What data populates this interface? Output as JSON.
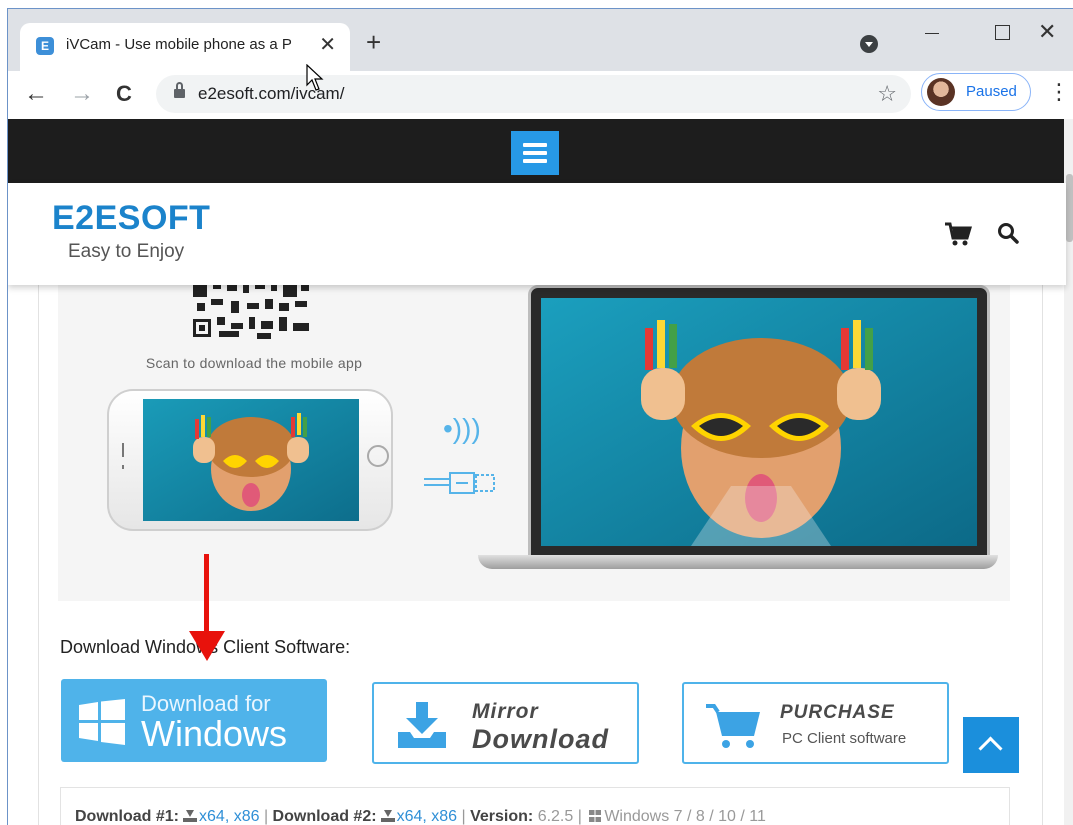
{
  "browser": {
    "tab_title": "iVCam - Use mobile phone as a P",
    "tab_favicon_letter": "E",
    "tab_close_glyph": "✕",
    "new_tab_glyph": "+",
    "url": "e2esoft.com/ivcam/",
    "profile_status": "Paused",
    "back_glyph": "←",
    "forward_glyph": "→",
    "reload_glyph": "C",
    "star_glyph": "☆",
    "menu_glyph": "⋮",
    "close_window_glyph": "✕"
  },
  "site": {
    "logo": "E2ESOFT",
    "tagline": "Easy to Enjoy",
    "accent_color": "#2799e6"
  },
  "hero": {
    "scan_text": "Scan to download the mobile app",
    "wireless_glyph": "•)))"
  },
  "download": {
    "heading": "Download Windows Client Software:",
    "windows_button": {
      "line1": "Download for",
      "line2": "Windows"
    },
    "mirror_button": {
      "line1": "Mirror",
      "line2": "Download"
    },
    "purchase_button": {
      "line1": "PURCHASE",
      "line2": "PC Client software"
    }
  },
  "info": {
    "label1": "Download #1:",
    "link1a": "x64",
    "link1b": "x86",
    "label2": "Download #2:",
    "link2a": "x64",
    "link2b": "x86",
    "version_label": "Version:",
    "version": "6.2.5",
    "windows_versions": "Windows 7 / 8 / 10 / 11"
  }
}
